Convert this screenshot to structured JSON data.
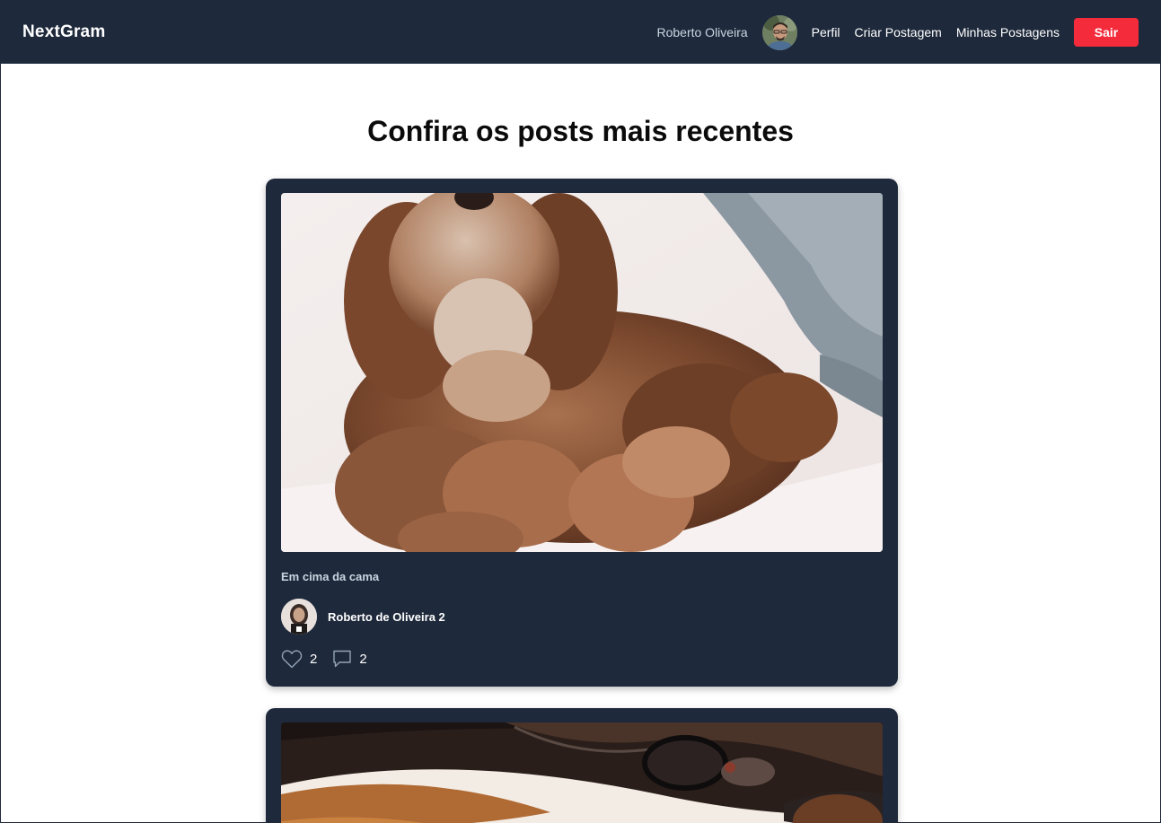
{
  "navbar": {
    "brand": "NextGram",
    "user_name": "Roberto Oliveira",
    "links": {
      "profile": "Perfil",
      "create_post": "Criar Postagem",
      "my_posts": "Minhas Postagens"
    },
    "logout_label": "Sair"
  },
  "page": {
    "title": "Confira os posts mais recentes"
  },
  "posts": [
    {
      "caption": "Em cima da cama",
      "author": "Roberto de Oliveira 2",
      "likes": "2",
      "comments": "2"
    }
  ],
  "colors": {
    "navbar_bg": "#1e293b",
    "card_bg": "#1e293b",
    "logout_bg": "#f42b3b",
    "page_bg": "#ffffff"
  },
  "icons": [
    "heart-icon",
    "comment-icon"
  ]
}
